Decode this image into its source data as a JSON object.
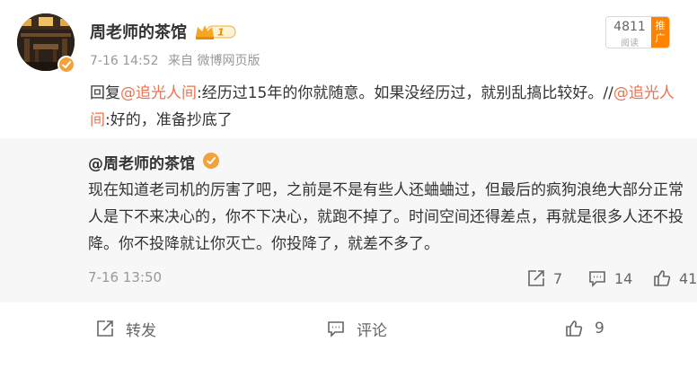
{
  "post": {
    "author": "周老师的茶馆",
    "vip_level": "1",
    "time": "7-16 14:52",
    "source": "来自 微博网页版",
    "read_count": "4811",
    "read_label": "阅读",
    "promote_label": "推广",
    "text": {
      "reply_prefix": "回复",
      "mention_1": "@追光人间",
      "part_1": ":经历过15年的你就随意。如果没经历过，就别乱搞比较好。//",
      "mention_2": "@追光人间",
      "part_2": ":好的，准备抄底了"
    }
  },
  "original": {
    "author": "@周老师的茶馆",
    "text": "现在知道老司机的厉害了吧，之前是不是有些人还蛐蛐过，但最后的疯狗浪绝大部分正常人是下不来决心的，你不下决心，就跑不掉了。时间空间还得差点，再就是很多人还不投降。你不投降就让你灭亡。你投降了，就差不多了。",
    "time": "7-16 13:50",
    "reposts": "7",
    "comments": "14",
    "likes": "41"
  },
  "actions": {
    "repost_label": "转发",
    "comment_label": "评论",
    "like_count": "9"
  },
  "icons": {
    "verified": "verified-badge-icon",
    "vip": "vip-crown-icon",
    "repost": "repost-icon",
    "comment": "comment-icon",
    "like": "thumbs-up-icon"
  },
  "colors": {
    "mention": "#eb7350",
    "promote": "#ff8200",
    "verified": "#f2a23a",
    "quote_bg": "#f7f7f7"
  }
}
